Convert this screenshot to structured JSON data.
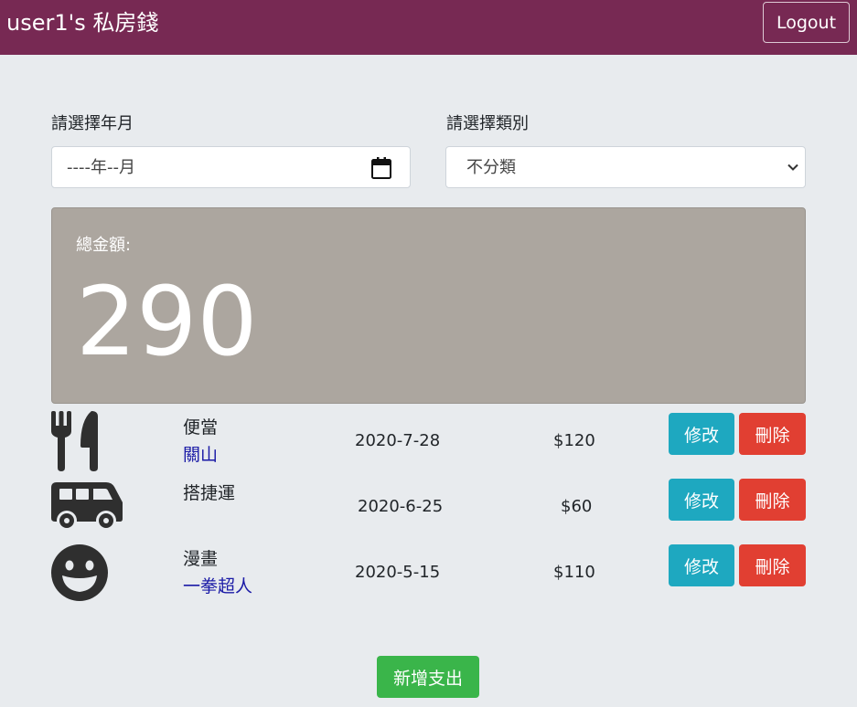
{
  "header": {
    "title": "user1's 私房錢",
    "logout_label": "Logout"
  },
  "filters": {
    "month_label": "請選擇年月",
    "month_value": "----年--月",
    "category_label": "請選擇類別",
    "category_value": "不分類"
  },
  "summary": {
    "total_label": "總金額:",
    "total_value": "290"
  },
  "expenses": [
    {
      "icon": "utensils-icon",
      "name": "便當",
      "note": "關山",
      "date": "2020-7-28",
      "amount": "$120",
      "edit_label": "修改",
      "delete_label": "刪除"
    },
    {
      "icon": "van-icon",
      "name": "搭捷運",
      "note": "",
      "date": "2020-6-25",
      "amount": "$60",
      "edit_label": "修改",
      "delete_label": "刪除"
    },
    {
      "icon": "grin-icon",
      "name": "漫畫",
      "note": "一拳超人",
      "date": "2020-5-15",
      "amount": "$110",
      "edit_label": "修改",
      "delete_label": "刪除"
    }
  ],
  "actions": {
    "add_label": "新增支出"
  },
  "colors": {
    "navbar": "#772953",
    "background": "#e8ebee",
    "total_card": "#aca69f",
    "edit_button": "#1ea8c0",
    "delete_button": "#e13f32",
    "add_button": "#3ab54a",
    "note_text": "#1a1aa6"
  }
}
